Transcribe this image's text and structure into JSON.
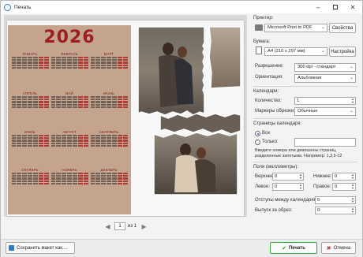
{
  "window": {
    "title": "Печать"
  },
  "preview": {
    "year": "2026",
    "months": [
      "ЯНВАРЬ",
      "ФЕВРАЛЬ",
      "МАРТ",
      "АПРЕЛЬ",
      "МАЙ",
      "ИЮНЬ",
      "ИЮЛЬ",
      "АВГУСТ",
      "СЕНТЯБРЬ",
      "ОКТЯБРЬ",
      "НОЯБРЬ",
      "ДЕКАБРЬ"
    ]
  },
  "pager": {
    "current": "1",
    "of_label": "из 1"
  },
  "printer": {
    "section_label": "Принтер:",
    "value": "Microsoft Print to PDF",
    "properties_button": "Свойства"
  },
  "paper": {
    "section_label": "Бумага:",
    "value": "A4 (210 x 297 мм)",
    "setup_button": "Настройка",
    "resolution_label": "Разрешение:",
    "resolution_value": "300 dpi - стандарт",
    "orientation_label": "Ориентация:",
    "orientation_value": "Альбомная"
  },
  "calendars": {
    "section_label": "Календари:",
    "count_label": "Количество:",
    "count_value": "1",
    "crop_label": "Маркеры обрезки:",
    "crop_value": "Обычные"
  },
  "pages": {
    "section_label": "Страницы календаря:",
    "all_label": "Все",
    "only_label": "Только:",
    "only_value": "",
    "hint": "Введите номера или диапазоны страниц, разделенные запятыми. Например: 1,3,5-12"
  },
  "margins": {
    "section_label": "Поля (миллиметры):",
    "top_label": "Верхнее:",
    "top_value": "0",
    "bottom_label": "Нижнее:",
    "bottom_value": "0",
    "left_label": "Левое:",
    "left_value": "0",
    "right_label": "Правое:",
    "right_value": "0",
    "spacing_label": "Отступы между календарями:",
    "spacing_value": "5",
    "bleed_label": "Выпуск за обрез:",
    "bleed_value": "0"
  },
  "footer": {
    "save_label": "Сохранить макет как....",
    "print_label": "Печать",
    "cancel_label": "Отмена"
  },
  "colors": {
    "accent": "#1d63c7",
    "print_button_border": "#3aa33a",
    "calendar_bg": "#c4a38f",
    "year_red": "#9c1f1f"
  }
}
